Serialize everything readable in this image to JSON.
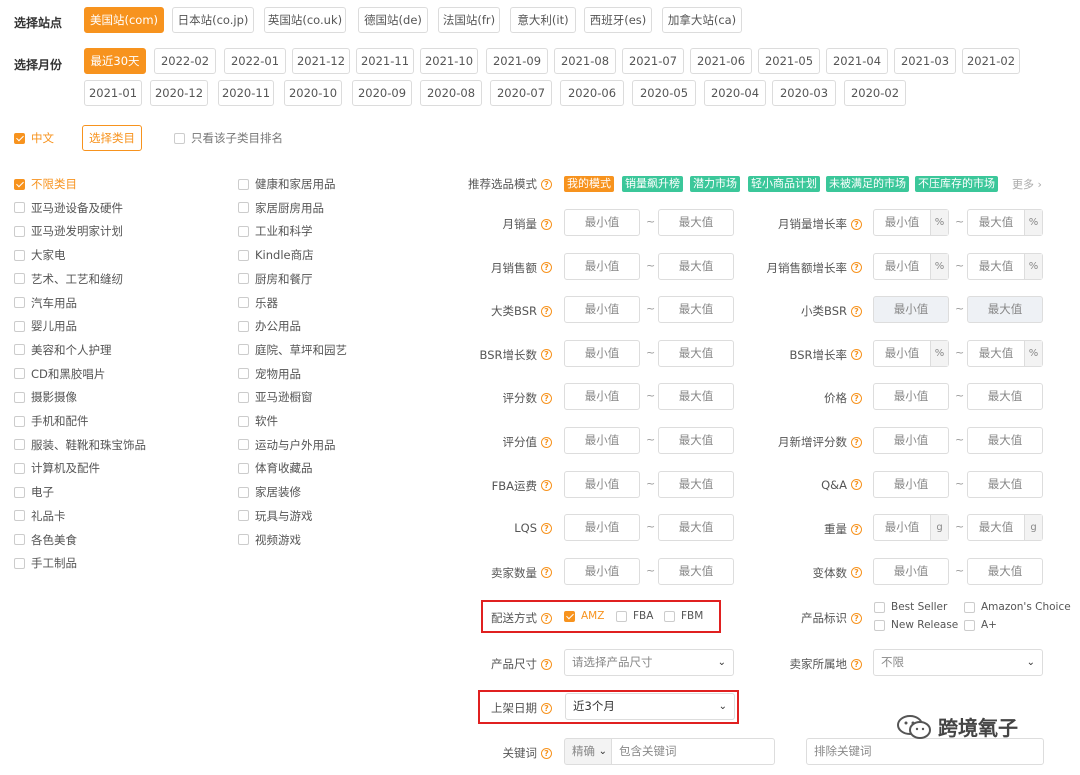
{
  "site": {
    "label": "选择站点",
    "options": [
      "美国站(com)",
      "日本站(co.jp)",
      "英国站(co.uk)",
      "德国站(de)",
      "法国站(fr)",
      "意大利(it)",
      "西班牙(es)",
      "加拿大站(ca)"
    ],
    "selected": "美国站(com)"
  },
  "month": {
    "label": "选择月份",
    "row1": [
      "最近30天",
      "2022-02",
      "2022-01",
      "2021-12",
      "2021-11",
      "2021-10",
      "2021-09",
      "2021-08",
      "2021-07",
      "2021-06",
      "2021-05",
      "2021-04",
      "2021-03",
      "2021-02"
    ],
    "row2": [
      "2021-01",
      "2020-12",
      "2020-11",
      "2020-10",
      "2020-09",
      "2020-08",
      "2020-07",
      "2020-06",
      "2020-05",
      "2020-04",
      "2020-03",
      "2020-02"
    ],
    "selected": "最近30天"
  },
  "lang": {
    "chinese": "中文",
    "chinese_checked": true,
    "select_category": "选择类目",
    "only_sub": "只看该子类目排名"
  },
  "categories": {
    "col1": [
      "不限类目",
      "亚马逊设备及硬件",
      "亚马逊发明家计划",
      "大家电",
      "艺术、工艺和缝纫",
      "汽车用品",
      "婴儿用品",
      "美容和个人护理",
      "CD和黑胶唱片",
      "摄影摄像",
      "手机和配件",
      "服装、鞋靴和珠宝饰品",
      "计算机及配件",
      "电子",
      "礼品卡",
      "各色美食",
      "手工制品"
    ],
    "col2": [
      "健康和家居用品",
      "家居厨房用品",
      "工业和科学",
      "Kindle商店",
      "厨房和餐厅",
      "乐器",
      "办公用品",
      "庭院、草坪和园艺",
      "宠物用品",
      "亚马逊橱窗",
      "软件",
      "运动与户外用品",
      "体育收藏品",
      "家居装修",
      "玩具与游戏",
      "视频游戏"
    ],
    "selected": "不限类目"
  },
  "mode": {
    "label": "推荐选品模式",
    "tags": [
      {
        "text": "我的模式",
        "color": "orange"
      },
      {
        "text": "销量飙升榜",
        "color": "green"
      },
      {
        "text": "潜力市场",
        "color": "green"
      },
      {
        "text": "轻小商品计划",
        "color": "green"
      },
      {
        "text": "未被满足的市场",
        "color": "green"
      },
      {
        "text": "不压库存的市场",
        "color": "green"
      }
    ],
    "more": "更多"
  },
  "placeholders": {
    "min": "最小值",
    "max": "最大值"
  },
  "fields_left": [
    "月销量",
    "月销售额",
    "大类BSR",
    "BSR增长数",
    "评分数",
    "评分值",
    "FBA运费",
    "LQS",
    "卖家数量"
  ],
  "fields_right": [
    {
      "label": "月销量增长率",
      "unit": "%"
    },
    {
      "label": "月销售额增长率",
      "unit": "%"
    },
    {
      "label": "小类BSR",
      "unit": ""
    },
    {
      "label": "BSR增长率",
      "unit": "%"
    },
    {
      "label": "价格",
      "unit": ""
    },
    {
      "label": "月新增评分数",
      "unit": ""
    },
    {
      "label": "Q&A",
      "unit": ""
    },
    {
      "label": "重量",
      "unit": "g"
    },
    {
      "label": "变体数",
      "unit": ""
    }
  ],
  "shipping": {
    "label": "配送方式",
    "options": [
      "AMZ",
      "FBA",
      "FBM"
    ],
    "checked": "AMZ"
  },
  "product_tag": {
    "label": "产品标识",
    "options": [
      "Best Seller",
      "Amazon's Choice",
      "New Release",
      "A+"
    ]
  },
  "size": {
    "label": "产品尺寸",
    "placeholder": "请选择产品尺寸"
  },
  "seller_loc": {
    "label": "卖家所属地",
    "value": "不限"
  },
  "date": {
    "label": "上架日期",
    "value": "近3个月"
  },
  "keyword": {
    "label": "关键词",
    "match": "精确",
    "include_ph": "包含关键词",
    "exclude_ph": "排除关键词"
  },
  "watermark": "跨境氧子",
  "colors": {
    "accent": "#f7931e",
    "green": "#3bc79a",
    "red": "#e02020"
  }
}
